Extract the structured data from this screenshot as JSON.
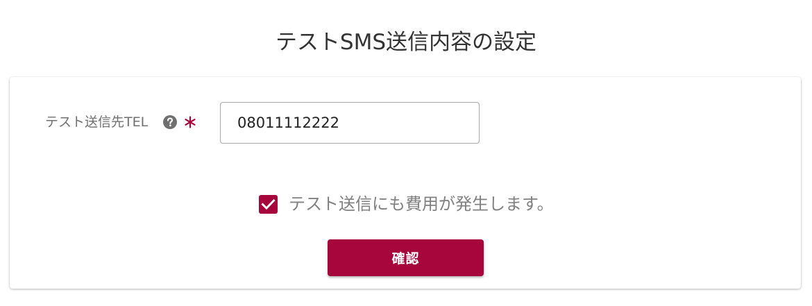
{
  "page": {
    "title": "テストSMS送信内容の設定"
  },
  "form": {
    "tel_label": "テスト送信先TEL",
    "help_icon": "question-circle-icon",
    "required_icon": "asterisk-icon",
    "tel_value": "08011112222",
    "checkbox_checked": true,
    "checkbox_label": "テスト送信にも費用が発生します。",
    "confirm_label": "確認"
  },
  "colors": {
    "accent": "#a6063b",
    "help_icon": "#707070",
    "label_text": "#707070",
    "title_text": "#333333"
  }
}
